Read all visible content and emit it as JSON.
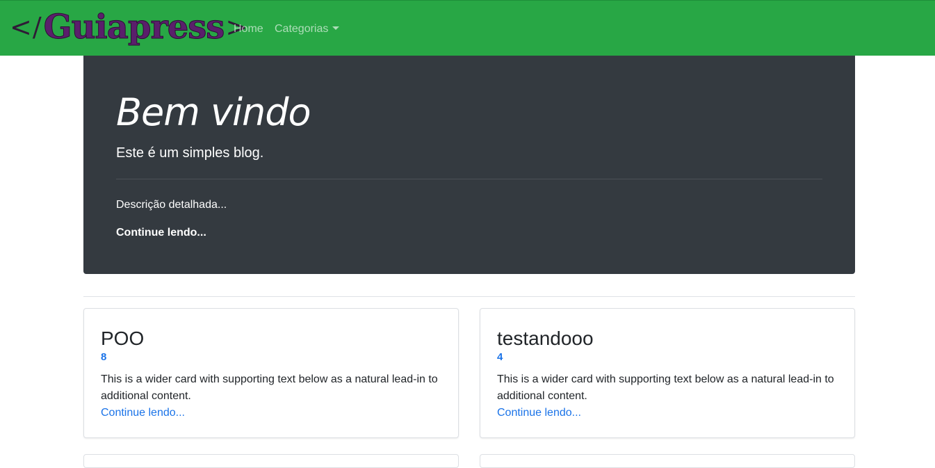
{
  "navbar": {
    "brand": {
      "open_bracket": "</",
      "name": "Guiapress",
      "close_bracket": ">"
    },
    "links": [
      {
        "label": "Home"
      },
      {
        "label": "Categorias"
      }
    ],
    "background_color": "#28a745"
  },
  "jumbotron": {
    "title": "Bem vindo",
    "lead": "Este é um simples blog.",
    "description": "Descrição detalhada...",
    "read_more": "Continue lendo...",
    "background_color": "#343a40"
  },
  "articles": [
    {
      "title": "POO",
      "count": "8",
      "text": "This is a wider card with supporting text below as a natural lead-in to additional content.",
      "link": "Continue lendo..."
    },
    {
      "title": "testandooo",
      "count": "4",
      "text": "This is a wider card with supporting text below as a natural lead-in to additional content.",
      "link": "Continue lendo..."
    }
  ],
  "colors": {
    "link": "#1a73e8",
    "brand_text": "#5a1f6b"
  }
}
